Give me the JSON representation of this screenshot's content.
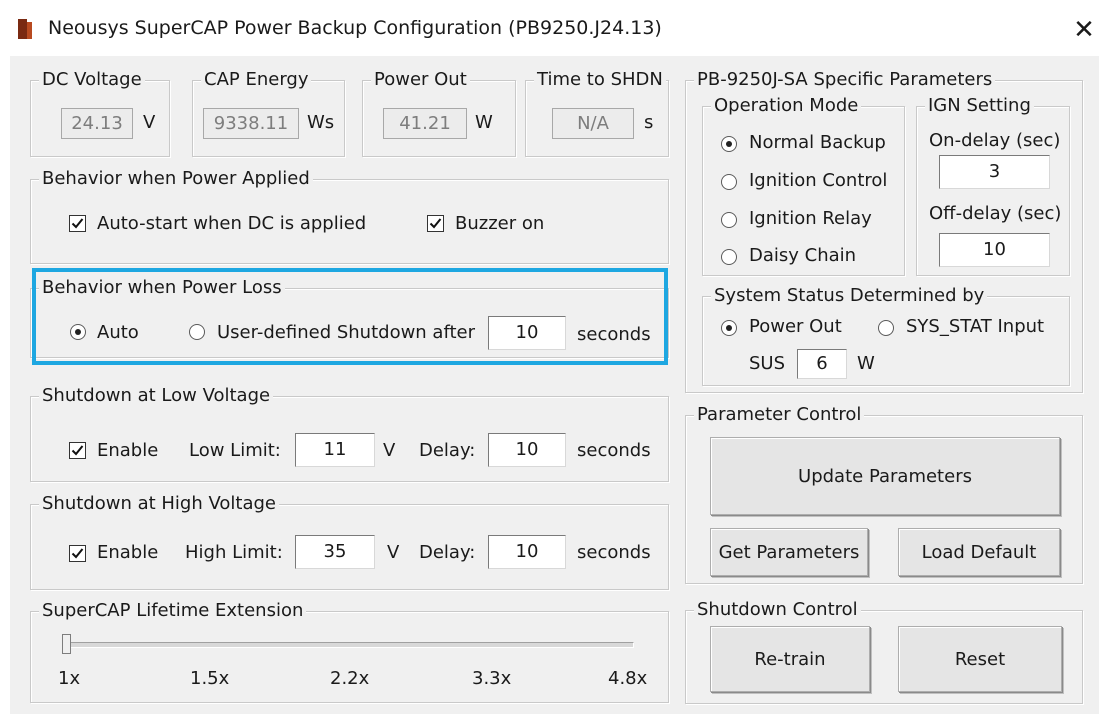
{
  "window": {
    "title": "Neousys SuperCAP Power Backup Configuration (PB9250.J24.13)",
    "close_glyph": "✕"
  },
  "readouts": {
    "dc_voltage": {
      "label": "DC Voltage",
      "value": "24.13",
      "unit": "V"
    },
    "cap_energy": {
      "label": "CAP Energy",
      "value": "9338.11",
      "unit": "Ws"
    },
    "power_out": {
      "label": "Power Out",
      "value": "41.21",
      "unit": "W"
    },
    "time_to_shdn": {
      "label": "Time to SHDN",
      "value": "N/A",
      "unit": "s"
    }
  },
  "power_applied": {
    "label": "Behavior when Power Applied",
    "autostart": {
      "label": "Auto-start when DC is applied",
      "checked": true
    },
    "buzzer": {
      "label": "Buzzer on",
      "checked": true
    }
  },
  "power_loss": {
    "label": "Behavior when Power Loss",
    "auto_label": "Auto",
    "user_label": "User-defined Shutdown after",
    "seconds_value": "10",
    "seconds_label": "seconds",
    "selected": "auto"
  },
  "low_voltage": {
    "label": "Shutdown at Low Voltage",
    "enable_label": "Enable",
    "enabled": true,
    "limit_label": "Low Limit:",
    "limit_value": "11",
    "unit": "V",
    "delay_label": "Delay:",
    "delay_value": "10",
    "seconds_label": "seconds"
  },
  "high_voltage": {
    "label": "Shutdown at High Voltage",
    "enable_label": "Enable",
    "enabled": true,
    "limit_label": "High Limit:",
    "limit_value": "35",
    "unit": "V",
    "delay_label": "Delay:",
    "delay_value": "10",
    "seconds_label": "seconds"
  },
  "lifetime": {
    "label": "SuperCAP Lifetime Extension",
    "ticks": [
      "1x",
      "1.5x",
      "2.2x",
      "3.3x",
      "4.8x"
    ],
    "selected": "1x"
  },
  "specific": {
    "label": "PB-9250J-SA Specific Parameters",
    "operation_mode": {
      "label": "Operation Mode",
      "options": [
        "Normal Backup",
        "Ignition Control",
        "Ignition Relay",
        "Daisy Chain"
      ],
      "selected": "Normal Backup"
    },
    "ign": {
      "label": "IGN Setting",
      "on_delay_label": "On-delay (sec)",
      "on_delay_value": "3",
      "off_delay_label": "Off-delay (sec)",
      "off_delay_value": "10"
    },
    "system_status": {
      "label": "System Status Determined by",
      "power_out_label": "Power Out",
      "sys_stat_label": "SYS_STAT Input",
      "selected": "Power Out",
      "sus_label": "SUS",
      "sus_value": "6",
      "sus_unit": "W"
    }
  },
  "parameter_control": {
    "label": "Parameter Control",
    "update": "Update Parameters",
    "get": "Get Parameters",
    "load_default": "Load Default"
  },
  "shutdown_control": {
    "label": "Shutdown Control",
    "retrain": "Re-train",
    "reset": "Reset"
  },
  "colors": {
    "highlight": "#1ea7e1",
    "dialog_bg": "#f0f0f0"
  }
}
